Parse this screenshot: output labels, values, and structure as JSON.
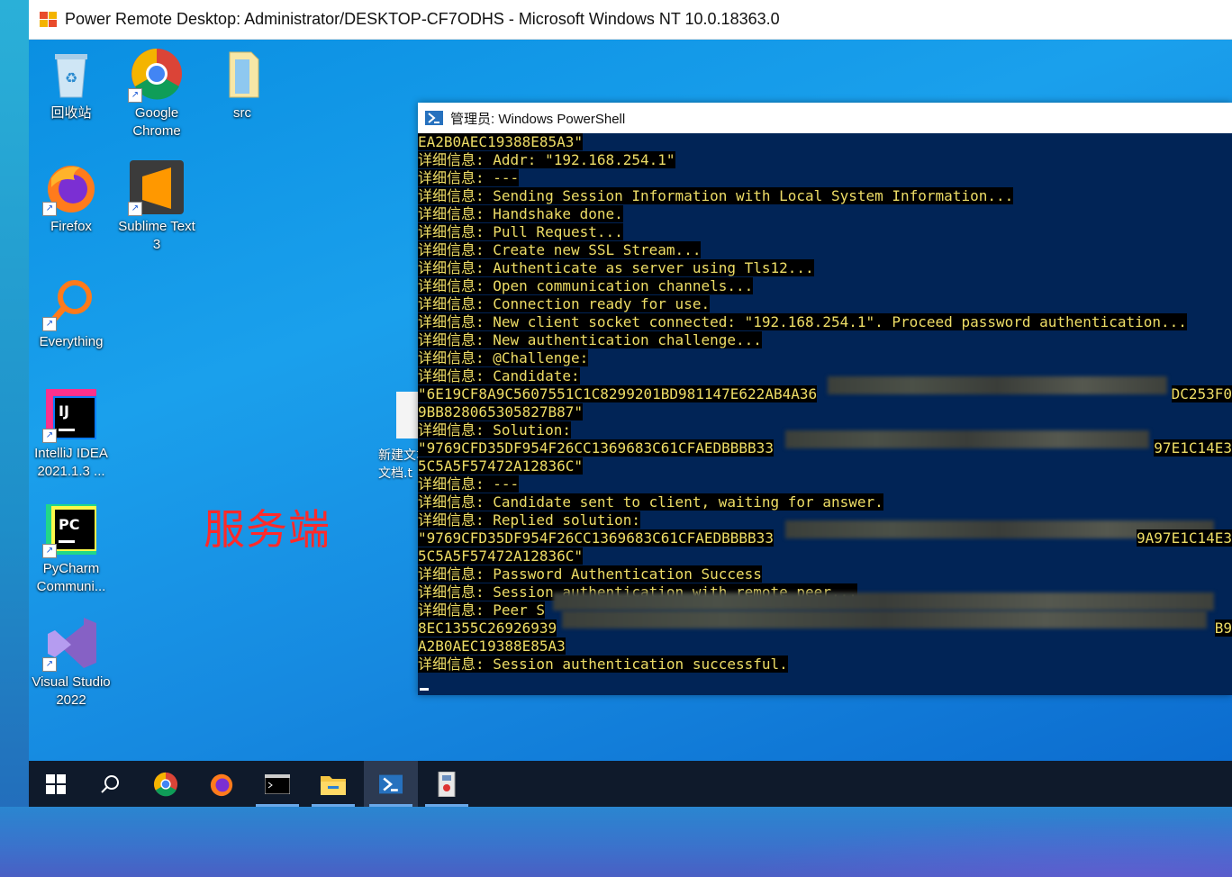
{
  "rdp": {
    "title": "Power Remote Desktop: Administrator/DESKTOP-CF7ODHS - Microsoft Windows NT 10.0.18363.0"
  },
  "desktop": {
    "icons": [
      {
        "label": "回收站"
      },
      {
        "label": "Google Chrome"
      },
      {
        "label": "src"
      },
      {
        "label": "Firefox"
      },
      {
        "label": "Sublime Text 3"
      },
      {
        "label": "Everything"
      },
      {
        "label": "IntelliJ IDEA 2021.1.3 ..."
      },
      {
        "label": "PyCharm Communi..."
      },
      {
        "label": "Visual Studio 2022"
      },
      {
        "label": "新建文本文档.t"
      }
    ],
    "overlay_label": "服务端",
    "overlay_color": "#ff2a2a"
  },
  "powershell": {
    "title": "管理员: Windows PowerShell",
    "background": "#012456",
    "lines": [
      "EA2B0AEC19388E85A3\"",
      "详细信息: Addr: \"192.168.254.1\"",
      "详细信息: ---",
      "详细信息: Sending Session Information with Local System Information...",
      "详细信息: Handshake done.",
      "详细信息: Pull Request...",
      "详细信息: Create new SSL Stream...",
      "详细信息: Authenticate as server using Tls12...",
      "详细信息: Open communication channels...",
      "详细信息: Connection ready for use.",
      "详细信息: New client socket connected: \"192.168.254.1\". Proceed password authentication...",
      "详细信息: New authentication challenge...",
      "详细信息: @Challenge:",
      "详细信息: Candidate:",
      "\"6E19CF8A9C5607551C1C8299201BD981147E622AB4A36",
      "9BB828065305827B87\"",
      "详细信息: Solution:",
      "\"9769CFD35DF954F26CC1369683C61CFAEDBBBB33",
      "5C5A5F57472A12836C\"",
      "详细信息: ---",
      "详细信息: Candidate sent to client, waiting for answer.",
      "详细信息: Replied solution:",
      "\"9769CFD35DF954F26CC1369683C61CFAEDBBBB33",
      "5C5A5F57472A12836C\"",
      "详细信息: Password Authentication Success",
      "详细信息: Session authentication with remote peer...",
      "详细信息: Peer S",
      "8EC1355C26926939",
      "A2B0AEC19388E85A3",
      "详细信息: Session authentication successful."
    ],
    "tails": [
      {
        "line": 14,
        "text": "DC253F0"
      },
      {
        "line": 17,
        "text": "97E1C14E3"
      },
      {
        "line": 22,
        "text": "9A97E1C14E3"
      },
      {
        "line": 27,
        "text": "B9"
      }
    ]
  },
  "taskbar": {
    "items": [
      "start-icon",
      "search-icon",
      "chrome-icon",
      "firefox-icon",
      "terminal-icon",
      "file-explorer-icon",
      "powershell-icon",
      "remote-app-icon"
    ],
    "active": "powershell-icon"
  }
}
